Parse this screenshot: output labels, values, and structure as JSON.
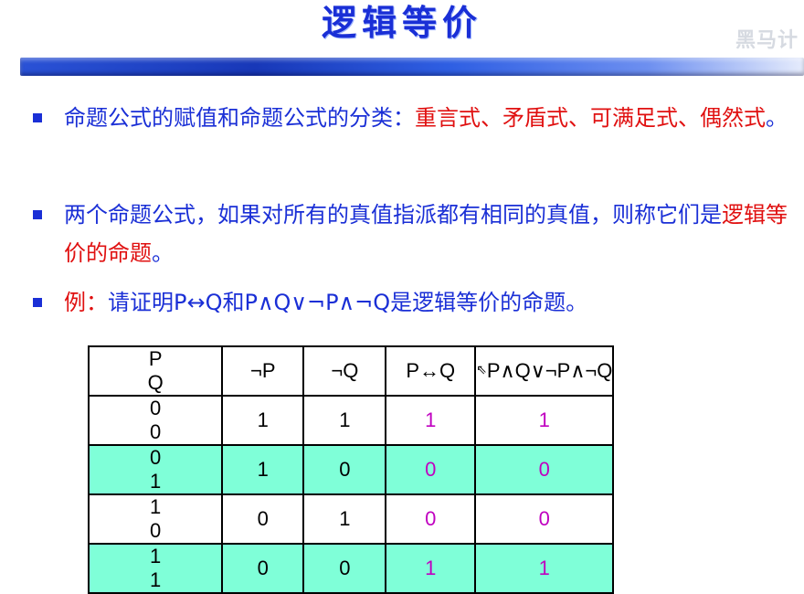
{
  "slide": {
    "title": "逻辑等价",
    "watermark": "黑马计",
    "colors": {
      "title": "#1a2fd6",
      "body_text": "#1a2fd6",
      "highlight": "#e01010",
      "bullet": "#1a2fd6",
      "table_shade": "#7fffd8",
      "magenta_values": "#c000c0"
    },
    "bullets": [
      {
        "segments": [
          {
            "text": "命题公式的赋值和命题公式的分类：",
            "color": "blue"
          },
          {
            "text": "重言式、矛盾式、可满足式、偶然式",
            "color": "red"
          },
          {
            "text": "。",
            "color": "blue"
          }
        ]
      },
      {
        "segments": [
          {
            "text": "两个命题公式，如果对所有的真值指派都有相同的真值，则称它们是",
            "color": "blue"
          },
          {
            "text": "逻辑等价的命题",
            "color": "red"
          },
          {
            "text": "。",
            "color": "blue"
          }
        ]
      },
      {
        "segments": [
          {
            "text": "例：",
            "color": "red"
          },
          {
            "text": "请证明P↔Q和P∧Q∨¬P∧¬Q是逻辑等价的命题。",
            "color": "blue"
          }
        ]
      }
    ],
    "table": {
      "headers": [
        "P",
        "Q",
        "¬P",
        "¬Q",
        "P↔Q",
        "P∧Q∨¬P∧¬Q"
      ],
      "rows": [
        [
          "0",
          "0",
          "1",
          "1",
          "1",
          "1"
        ],
        [
          "0",
          "1",
          "1",
          "0",
          "0",
          "0"
        ],
        [
          "1",
          "0",
          "0",
          "1",
          "0",
          "0"
        ],
        [
          "1",
          "1",
          "0",
          "0",
          "1",
          "1"
        ]
      ]
    }
  }
}
